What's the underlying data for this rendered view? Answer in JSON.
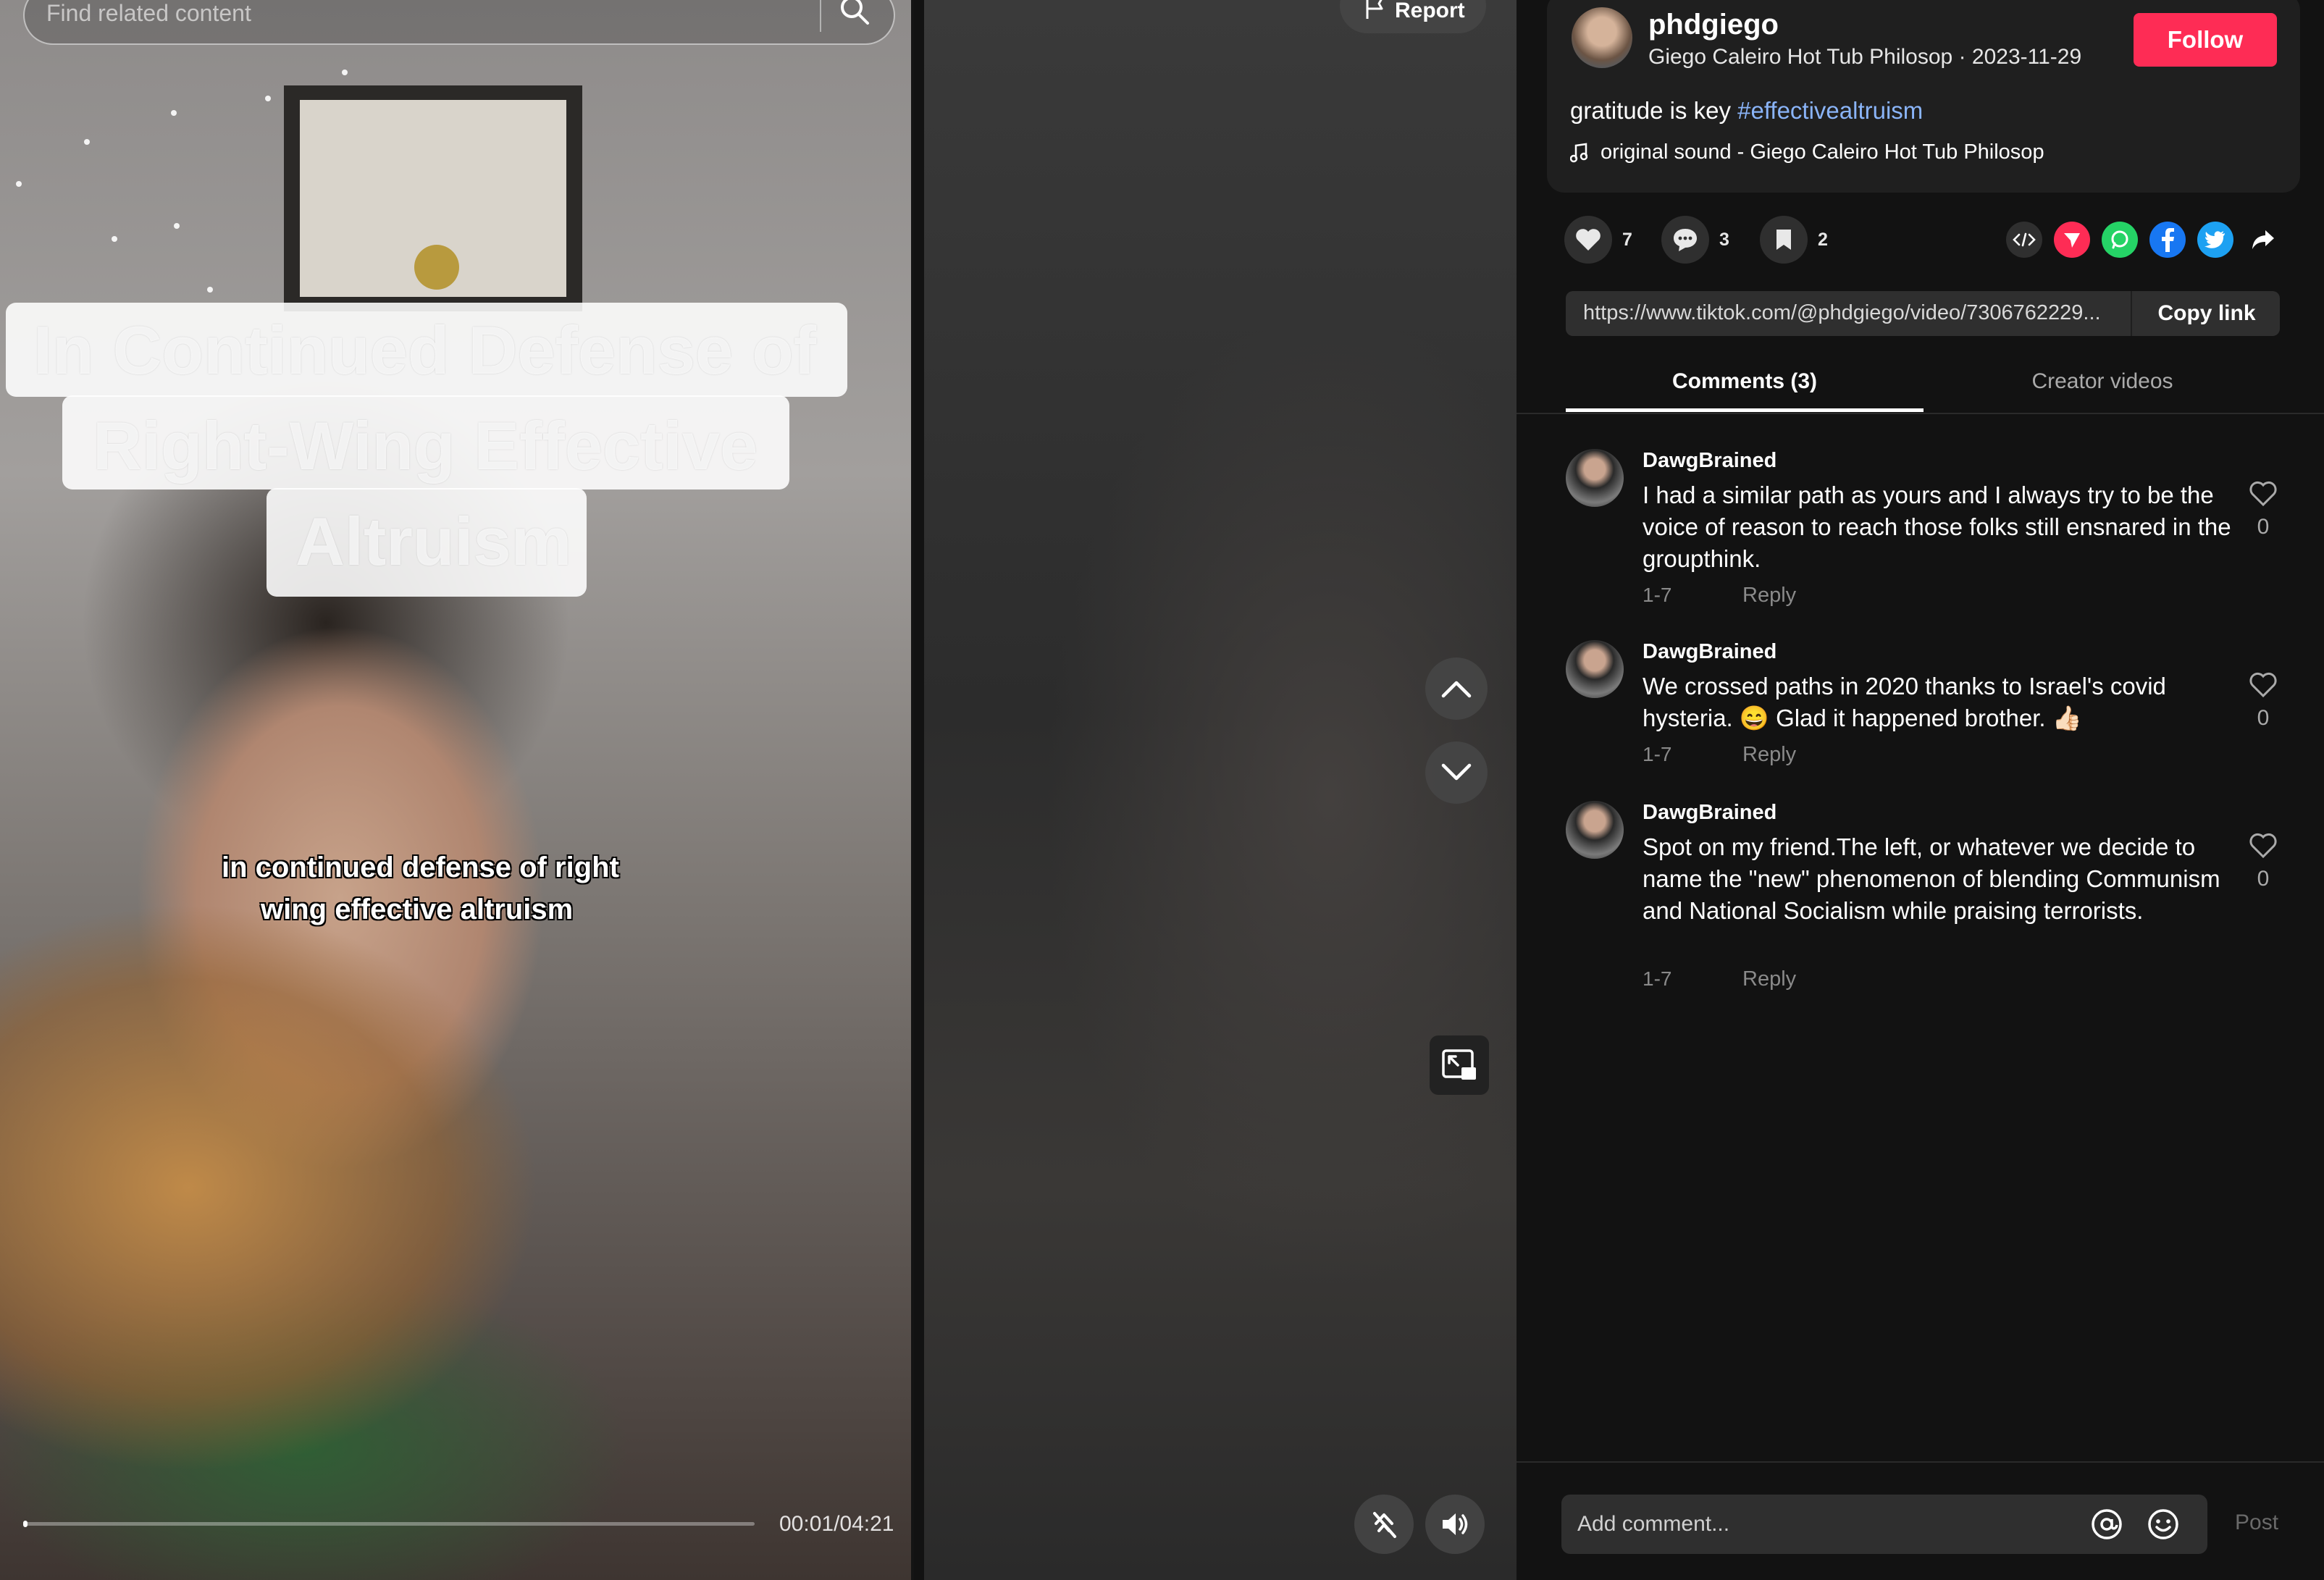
{
  "search": {
    "placeholder": "Find related content"
  },
  "video": {
    "title_lines": [
      "In Continued Defense of",
      "Right-Wing Effective",
      "Altruism"
    ],
    "caption_lines": [
      "in continued defense of right",
      "wing effective altruism"
    ],
    "current_time": "00:01",
    "duration": "04:21",
    "time_display": "00:01/04:21",
    "progress_fraction": 0.004
  },
  "controls": {
    "report_label": "Report",
    "icons": [
      "search-icon",
      "flag-icon",
      "chevron-up-icon",
      "chevron-down-icon",
      "picture-in-picture-icon",
      "no-autoscroll-icon",
      "volume-icon"
    ]
  },
  "author": {
    "username": "phdgiego",
    "meta": "Giego Caleiro Hot Tub Philosop · 2023-11-29",
    "follow_label": "Follow"
  },
  "post": {
    "description_text": "gratitude is key ",
    "hashtag": "#effectivealtruism",
    "sound": "original sound - Giego Caleiro Hot Tub Philosop"
  },
  "actions": {
    "likes": "7",
    "comments": "3",
    "saves": "2"
  },
  "share": {
    "icons": [
      "embed-icon",
      "send-icon",
      "whatsapp-icon",
      "facebook-icon",
      "twitter-icon",
      "share-arrow-icon"
    ],
    "link": "https://www.tiktok.com/@phdgiego/video/7306762229...",
    "copy_label": "Copy link"
  },
  "tabs": [
    {
      "label": "Comments (3)",
      "active": true
    },
    {
      "label": "Creator videos",
      "active": false
    }
  ],
  "comments": [
    {
      "user": "DawgBrained",
      "text": "I had a similar path as yours and I always try to be the voice of reason to reach those folks still ensnared in the groupthink.",
      "date": "1-7",
      "reply_label": "Reply",
      "likes": "0"
    },
    {
      "user": "DawgBrained",
      "text": "We crossed paths in 2020 thanks to Israel's covid hysteria. 😄 Glad it happened brother. 👍🏻",
      "date": "1-7",
      "reply_label": "Reply",
      "likes": "0"
    },
    {
      "user": "DawgBrained",
      "text": "Spot on my friend.The left, or whatever we decide to name the \"new\" phenomenon of blending Communism and National Socialism while praising terrorists.",
      "date": "1-7",
      "reply_label": "Reply",
      "likes": "0"
    }
  ],
  "composer": {
    "placeholder": "Add comment...",
    "post_label": "Post"
  },
  "colors": {
    "follow": "#fe2c55",
    "hashtag": "#8ab4f8",
    "panel_bg": "#121212",
    "card_bg": "#1f1f1f"
  }
}
